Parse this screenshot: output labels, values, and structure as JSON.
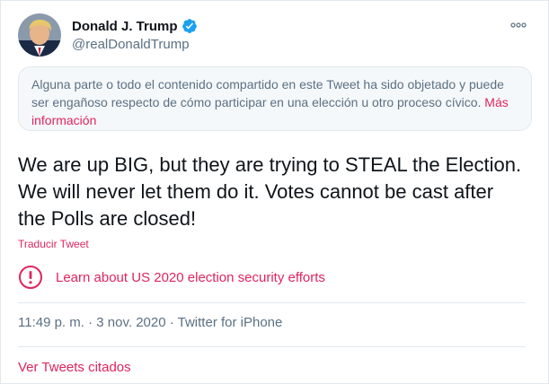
{
  "tweet": {
    "author": {
      "display_name": "Donald J. Trump",
      "handle": "@realDonaldTrump",
      "verified": true
    },
    "notice": {
      "text": "Alguna parte o todo el contenido compartido en este Tweet ha sido objetado y puede ser engañoso respecto de cómo participar en una elección u otro proceso cívico.",
      "link_label": "Más información"
    },
    "body": "We are up BIG, but they are trying to STEAL the Election. We will never let them do it. Votes cannot be cast after the Polls are closed!",
    "translate_label": "Traducir Tweet",
    "election_link_label": "Learn about US 2020 election security efforts",
    "meta": {
      "time": "11:49 p. m.",
      "separator": " · ",
      "date": "3 nov. 2020",
      "source": "Twitter for iPhone"
    },
    "quoted_tweets_label": "Ver Tweets citados"
  },
  "colors": {
    "accent": "#e0245e",
    "verified": "#1da1f2",
    "secondary_text": "#5b7083",
    "border": "#e1e8ed"
  }
}
